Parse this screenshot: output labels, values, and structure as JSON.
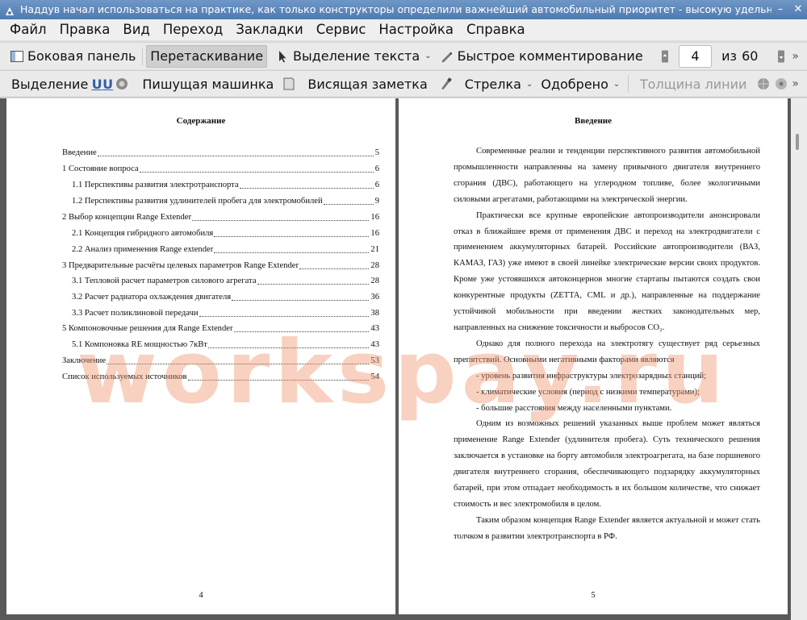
{
  "window": {
    "title": "Наддув начал использоваться на практике, как только конструкторы определили важнейший автомобильный приоритет - высокую удельную мощность ...",
    "buttons": {
      "minimize": "–",
      "close": "✕"
    }
  },
  "menu": [
    "Файл",
    "Правка",
    "Вид",
    "Переход",
    "Закладки",
    "Сервис",
    "Настройка",
    "Справка"
  ],
  "toolbar1": {
    "sidebar": "Боковая панель",
    "drag": "Перетаскивание",
    "text_select": "Выделение текста",
    "quick_comment": "Быстрое комментирование",
    "page_current": "4",
    "page_of": "из",
    "page_total": "60",
    "more": "»"
  },
  "toolbar2": {
    "highlight": "Выделение",
    "typewriter": "Пишущая машинка",
    "sticky_note": "Висящая заметка",
    "arrow": "Стрелка",
    "approved": "Одобрено",
    "line_width": "Толщина линии",
    "more": "»"
  },
  "left_page": {
    "title": "Содержание",
    "toc": [
      {
        "text": "Введение",
        "page": "5",
        "level": 0
      },
      {
        "text": "1 Состояние вопроса",
        "page": "6",
        "level": 0
      },
      {
        "text": "1.1 Перспективы развития электротранспорта",
        "page": "6",
        "level": 1
      },
      {
        "text": "1.2 Перспективы развития удлинителей пробега для электромобилей",
        "page": "9",
        "level": 1
      },
      {
        "text": "2 Выбор концепции Range Extender",
        "page": "16",
        "level": 0
      },
      {
        "text": "2.1 Концепция гибридного автомобиля",
        "page": "16",
        "level": 1
      },
      {
        "text": "2.2 Анализ применения Range extender",
        "page": "21",
        "level": 1
      },
      {
        "text": "3 Предварительные расчёты целевых параметров Range Extender",
        "page": "28",
        "level": 0
      },
      {
        "text": "3.1 Тепловой расчет параметров силового агрегата",
        "page": "28",
        "level": 1
      },
      {
        "text": "3.2 Расчет радиатора охлаждения двигателя",
        "page": "36",
        "level": 1
      },
      {
        "text": "3.3 Расчет поликлиновой передачи",
        "page": "38",
        "level": 1
      },
      {
        "text": "5 Компоновочные решения для Range Extender",
        "page": "43",
        "level": 0
      },
      {
        "text": "5.1 Компоновка RE мощностью 7кВт",
        "page": "43",
        "level": 1
      },
      {
        "text": "Заключение",
        "page": "53",
        "level": 0
      },
      {
        "text": "Список используемых источников",
        "page": "54",
        "level": 0
      }
    ],
    "page_number": "4"
  },
  "right_page": {
    "title": "Введение",
    "p1": "Современные реалии и тенденции перспективного развития автомобильной промышленности направленны на замену привычного двигателя внутреннего сгорания (ДВС), работающего на углеродном топливе, более экологичными силовыми агрегатами, работающими на электрической энергии.",
    "p2": "Практически все крупные европейские автопроизводители анонсировали отказ в ближайшее время от применения ДВС и переход на электродвигатели с применением аккумуляторных батарей. Российские автопроизводители (ВАЗ, КАМАЗ, ГАЗ) уже имеют в своей линейке электрические версии своих продуктов. Кроме уже устоявшихся автоконцернов многие стартапы пытаются создать свои конкурентные продукты (ZETTA, CML и др.), направленные на поддержание устойчивой мобильности при введении жестких законодательных мер, направленных на снижение токсичности и выбросов CO₂.",
    "p3": "Однако для полного перехода на электротягу существует ряд серьезных препятствий. Основными негативными факторами являются",
    "bullets": [
      "- уровень развития инфраструктуры электрозарядных станций;",
      "- климатические условия (период с низкими температурами);",
      "- большие расстояния между населенными пунктами."
    ],
    "p4": "Одним из возможных решений указанных выше проблем может являться применение Range Extender (удлинителя пробега). Суть технического решения заключается в установке на борту автомобиля электроагрегата, на базе поршневого двигателя внутреннего сгорания, обеспечивающего подзарядку аккумуляторных батарей, при этом отпадает необходимость в их большом количестве, что снижает стоимость и вес электромобиля в целом.",
    "p5": "Таким образом концепция Range Extender является актуальной и может стать толчком в развитии электротранспорта в РФ.",
    "page_number": "5"
  },
  "watermark": "workspay.ru"
}
